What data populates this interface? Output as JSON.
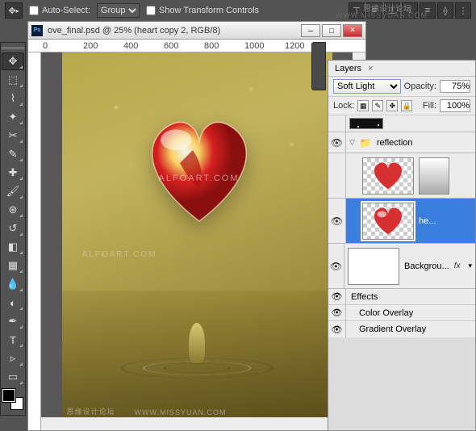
{
  "watermarks": {
    "top_text": "思缘设计论坛",
    "top_url": "WWW.MISSYUAN.COM",
    "canvas_center": "ALFOART.COM",
    "canvas_side": "ALFOART.COM",
    "bottom1": "思缘设计论坛",
    "bottom2": "WWW.MISSYUAN.COM"
  },
  "options_bar": {
    "auto_select_label": "Auto-Select:",
    "auto_select_value": "Group",
    "auto_select_checked": false,
    "show_transform_label": "Show Transform Controls",
    "show_transform_checked": false
  },
  "document": {
    "title": "ove_final.psd @ 25% (heart copy 2, RGB/8)",
    "ruler_marks": [
      "0",
      "200",
      "400",
      "600",
      "800",
      "1000",
      "1200"
    ]
  },
  "layers_panel": {
    "tab_label": "Layers",
    "blend_mode": "Soft Light",
    "opacity_label": "Opacity:",
    "opacity_value": "75%",
    "lock_label": "Lock:",
    "fill_label": "Fill:",
    "fill_value": "100%",
    "group_name": "reflection",
    "selected_layer_name": "he...",
    "background_name": "Backgrou...",
    "effects_label": "Effects",
    "effect1": "Color Overlay",
    "effect2": "Gradient Overlay",
    "fx": "fx"
  }
}
